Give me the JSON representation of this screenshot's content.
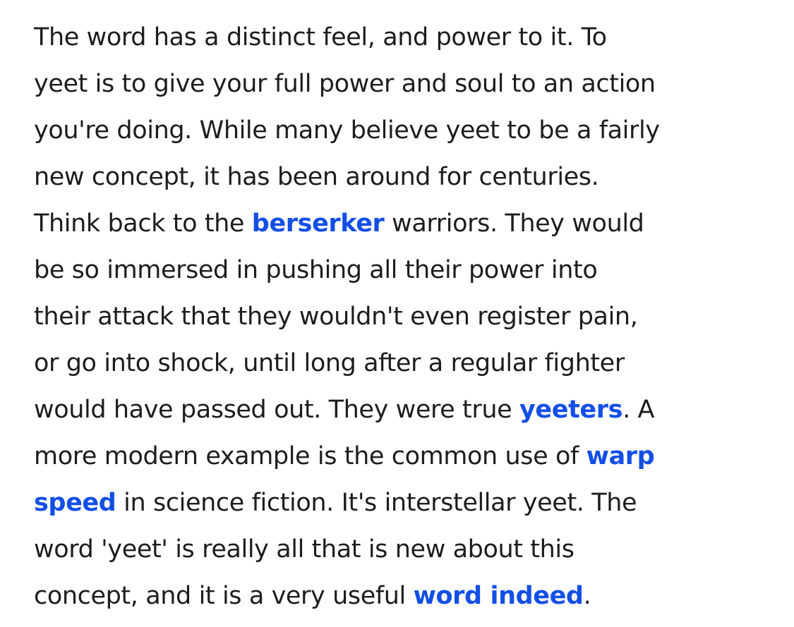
{
  "definition": {
    "lines": [
      {
        "text": "The word has a distinct feel, and power to it. To"
      },
      {
        "text": "yeet is to give your full power and soul to an action"
      },
      {
        "text": "you're doing. While many believe yeet to be a fairly"
      },
      {
        "text": "new concept, it has been around for centuries."
      },
      {
        "pre": "Think back to the ",
        "link": "berserker",
        "post": " warriors. They would"
      },
      {
        "text": "be so immersed in pushing all their power into"
      },
      {
        "text": "their attack that they wouldn't even register pain,"
      },
      {
        "text": "or go into shock, until long after a regular fighter"
      },
      {
        "pre": "would have passed out. They were true ",
        "link": "yeeters",
        "post": ". A"
      },
      {
        "pre": "more modern example is the common use of ",
        "link": "warp",
        "post": ""
      },
      {
        "pre": "",
        "link": "speed",
        "post": " in science fiction. It's interstellar yeet. The"
      },
      {
        "text": "word 'yeet' is really all that is new about this"
      },
      {
        "pre": "concept, and it is a very useful ",
        "link": "word indeed",
        "post": "."
      }
    ]
  },
  "colors": {
    "text": "#1d1d1f",
    "link": "#134fe6",
    "background": "#ffffff"
  }
}
